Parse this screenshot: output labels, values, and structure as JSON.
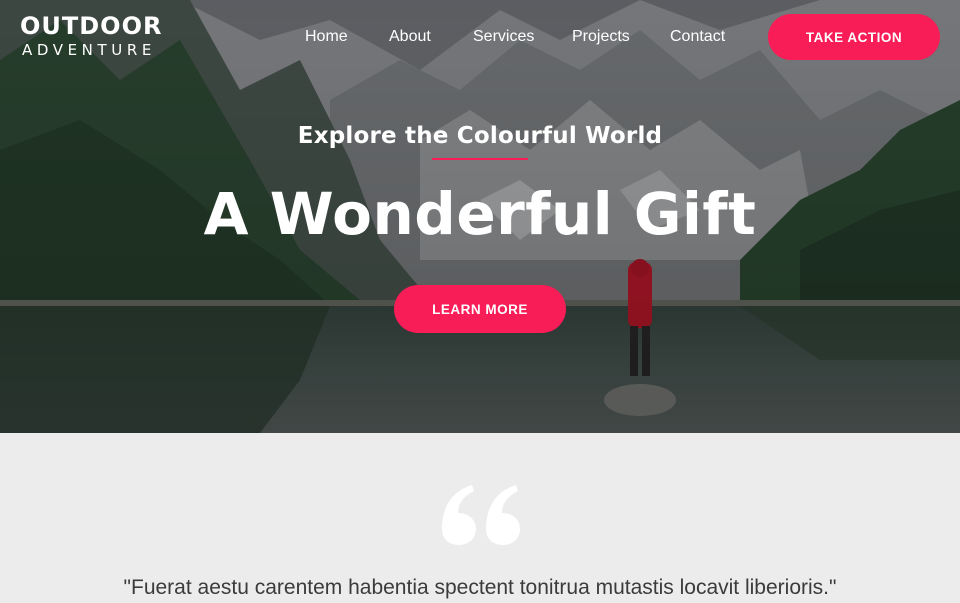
{
  "header": {
    "brand": {
      "line1": "OUTDOOR",
      "line2": "ADVENTURE"
    },
    "nav": [
      {
        "label": "Home"
      },
      {
        "label": "About"
      },
      {
        "label": "Services"
      },
      {
        "label": "Projects"
      },
      {
        "label": "Contact"
      }
    ],
    "cta_label": "TAKE ACTION"
  },
  "hero": {
    "subtitle": "Explore the Colourful World",
    "title": "A Wonderful Gift",
    "button_label": "LEARN MORE",
    "background": "mountain-lake-photo"
  },
  "testimonial": {
    "icon": "quote-icon",
    "quote": "\"Fuerat aestu carentem habentia spectent tonitrua mutastis locavit liberioris.\""
  },
  "colors": {
    "accent": "#f81c57",
    "section_bg": "#ececec",
    "text_dark": "#3b3b3b"
  }
}
